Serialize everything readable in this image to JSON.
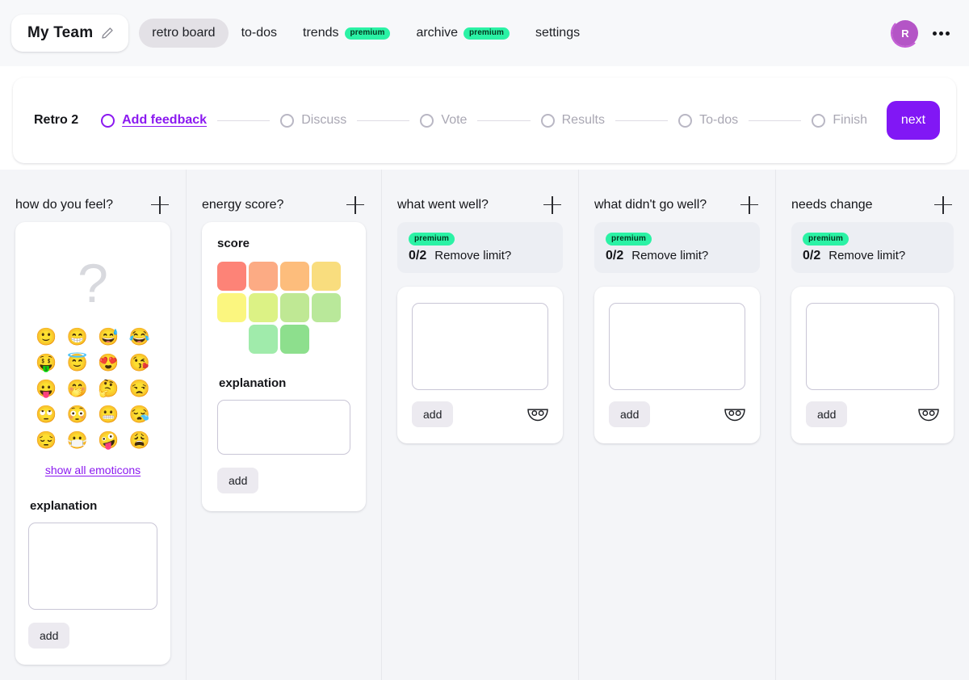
{
  "topbar": {
    "team_name": "My Team",
    "edit_icon": "pencil-icon",
    "nav": [
      {
        "label": "retro board",
        "active": true,
        "premium": null
      },
      {
        "label": "to-dos",
        "active": false,
        "premium": null
      },
      {
        "label": "trends",
        "active": false,
        "premium": "premium"
      },
      {
        "label": "archive",
        "active": false,
        "premium": "premium"
      },
      {
        "label": "settings",
        "active": false,
        "premium": null
      }
    ],
    "avatar_initial": "R",
    "menu_icon": "more-options-icon"
  },
  "stepper": {
    "retro_title": "Retro 2",
    "steps": [
      {
        "label": "Add feedback",
        "current": true
      },
      {
        "label": "Discuss",
        "current": false
      },
      {
        "label": "Vote",
        "current": false
      },
      {
        "label": "Results",
        "current": false
      },
      {
        "label": "To-dos",
        "current": false
      },
      {
        "label": "Finish",
        "current": false
      }
    ],
    "next_label": "next"
  },
  "colors": {
    "accent_purple": "#8117f5",
    "link_purple": "#8b19f0",
    "premium_green": "#2bf2a5",
    "avatar_purple": "#b455c6",
    "board_bg": "#f4f5f8"
  },
  "columns": [
    {
      "title": "how do you feel?",
      "add_icon": "plus-icon",
      "placeholder_glyph": "?",
      "emojis": [
        "🙂",
        "😁",
        "😅",
        "😂",
        "🤑",
        "😇",
        "😍",
        "😘",
        "😛",
        "🤭",
        "🤔",
        "😒",
        "🙄",
        "😳",
        "😬",
        "😪",
        "😔",
        "😷",
        "🤪",
        "😩"
      ],
      "show_all_label": "show all emoticons",
      "explanation_label": "explanation",
      "explanation_value": "",
      "add_label": "add"
    },
    {
      "title": "energy score?",
      "add_icon": "plus-icon",
      "score_label": "score",
      "score_swatches": [
        "#fd8377",
        "#fcab84",
        "#fdbd7c",
        "#f9dd7e",
        "#fbf67f",
        "#dcf285",
        "#bfe894",
        "#b9e89a",
        "#a0ebab",
        "#8ddf8d"
      ],
      "explanation_label": "explanation",
      "explanation_value": "",
      "add_label": "add"
    },
    {
      "title": "what went well?",
      "add_icon": "plus-icon",
      "premium_badge": "premium",
      "limit_count": "0/2",
      "limit_text": "Remove limit?",
      "entry_value": "",
      "add_label": "add",
      "anon_icon": "mask-icon"
    },
    {
      "title": "what didn't go well?",
      "add_icon": "plus-icon",
      "premium_badge": "premium",
      "limit_count": "0/2",
      "limit_text": "Remove limit?",
      "entry_value": "",
      "add_label": "add",
      "anon_icon": "mask-icon"
    },
    {
      "title": "needs change",
      "add_icon": "plus-icon",
      "premium_badge": "premium",
      "limit_count": "0/2",
      "limit_text": "Remove limit?",
      "entry_value": "",
      "add_label": "add",
      "anon_icon": "mask-icon"
    }
  ]
}
